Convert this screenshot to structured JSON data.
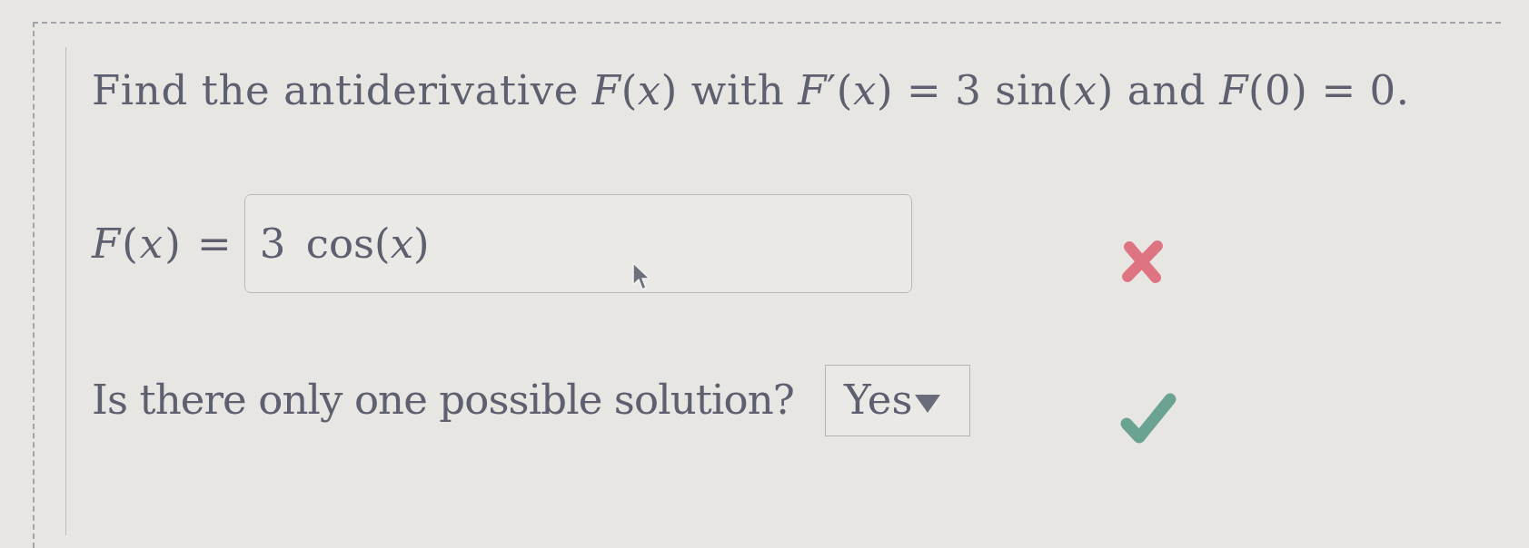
{
  "question": {
    "prompt": "Find the antiderivative *F*(*x*) with *F*′(*x*) = 3 sin(*x*) and *F*(0) = 0."
  },
  "answers": [
    {
      "kind": "formula",
      "label": "*F*(*x*) =",
      "value": "3 cos(*x*)",
      "correct": false
    },
    {
      "kind": "dropdown",
      "label": "Is there only one possible solution?",
      "value": "Yes",
      "correct": true
    }
  ]
}
